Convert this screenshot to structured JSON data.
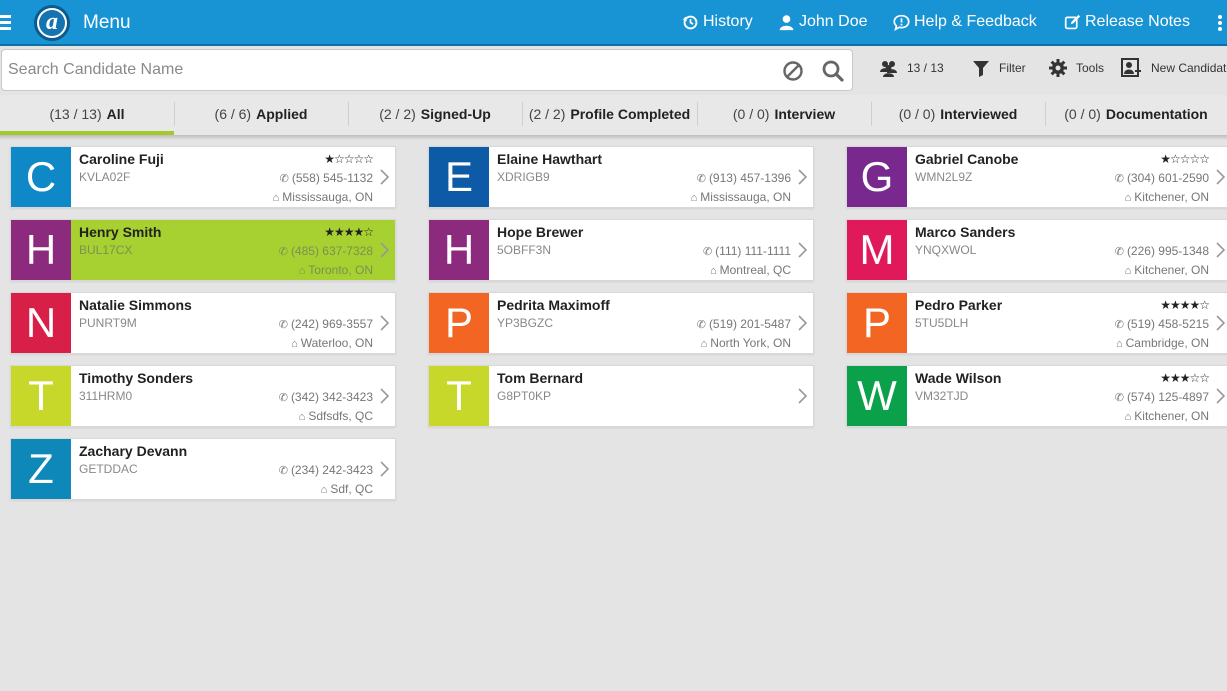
{
  "header": {
    "menu_label": "Menu",
    "logo_letter": "a",
    "nav": {
      "history": "History",
      "user": "John Doe",
      "help": "Help & Feedback",
      "release": "Release Notes"
    }
  },
  "toolbar": {
    "search_placeholder": "Search Candidate Name",
    "count": "13 / 13",
    "filter": "Filter",
    "tools": "Tools",
    "new_candidate": "New Candidate"
  },
  "tabs": [
    {
      "count": "(13 / 13)",
      "label": "All",
      "active": true
    },
    {
      "count": "(6 / 6)",
      "label": "Applied"
    },
    {
      "count": "(2 / 2)",
      "label": "Signed-Up"
    },
    {
      "count": "(2 / 2)",
      "label": "Profile Completed"
    },
    {
      "count": "(0 / 0)",
      "label": "Interview"
    },
    {
      "count": "(0 / 0)",
      "label": "Interviewed"
    },
    {
      "count": "(0 / 0)",
      "label": "Documentation"
    }
  ],
  "colors": {
    "header": "#1894d5",
    "accent": "#a3c92a",
    "selected_card": "#a6d130"
  },
  "candidates": [
    {
      "letter": "C",
      "color": "#0e88c7",
      "name": "Caroline Fuji",
      "code": "KVLA02F",
      "stars": "★☆☆☆☆",
      "phone": "(558) 545-1132",
      "city": "Mississauga, ON"
    },
    {
      "letter": "E",
      "color": "#0d5aa7",
      "name": "Elaine Hawthart",
      "code": "XDRIGB9",
      "stars": "",
      "phone": "(913) 457-1396",
      "city": "Mississauga, ON"
    },
    {
      "letter": "G",
      "color": "#79298e",
      "name": "Gabriel Canobe",
      "code": "WMN2L9Z",
      "stars": "★☆☆☆☆",
      "phone": "(304) 601-2590",
      "city": "Kitchener, ON"
    },
    {
      "letter": "H",
      "color": "#8c2a7e",
      "name": "Henry Smith",
      "code": "BUL17CX",
      "stars": "★★★★☆",
      "phone": "(485) 637-7328",
      "city": "Toronto, ON",
      "selected": true
    },
    {
      "letter": "H",
      "color": "#8c2a7e",
      "name": "Hope Brewer",
      "code": "5OBFF3N",
      "stars": "",
      "phone": "(111) 111-1111",
      "city": "Montreal, QC"
    },
    {
      "letter": "M",
      "color": "#e0195b",
      "name": "Marco Sanders",
      "code": "YNQXWOL",
      "stars": "",
      "phone": "(226) 995-1348",
      "city": "Kitchener, ON"
    },
    {
      "letter": "N",
      "color": "#d81f48",
      "name": "Natalie Simmons",
      "code": "PUNRT9M",
      "stars": "",
      "phone": "(242) 969-3557",
      "city": "Waterloo, ON"
    },
    {
      "letter": "P",
      "color": "#f26522",
      "name": "Pedrita Maximoff",
      "code": "YP3BGZC",
      "stars": "",
      "phone": "(519) 201-5487",
      "city": "North York, ON"
    },
    {
      "letter": "P",
      "color": "#f26522",
      "name": "Pedro Parker",
      "code": "5TU5DLH",
      "stars": "★★★★☆",
      "phone": "(519) 458-5215",
      "city": "Cambridge, ON"
    },
    {
      "letter": "T",
      "color": "#c8d82a",
      "name": "Timothy Sonders",
      "code": "311HRM0",
      "stars": "",
      "phone": "(342) 342-3423",
      "city": "Sdfsdfs, QC"
    },
    {
      "letter": "T",
      "color": "#c8d82a",
      "name": "Tom Bernard",
      "code": "G8PT0KP",
      "stars": "",
      "phone": "",
      "city": ""
    },
    {
      "letter": "W",
      "color": "#0aa14a",
      "name": "Wade Wilson",
      "code": "VM32TJD",
      "stars": "★★★☆☆",
      "phone": "(574) 125-4897",
      "city": "Kitchener, ON"
    },
    {
      "letter": "Z",
      "color": "#0e88b8",
      "name": "Zachary Devann",
      "code": "GETDDAC",
      "stars": "",
      "phone": "(234) 242-3423",
      "city": "Sdf, QC"
    }
  ]
}
